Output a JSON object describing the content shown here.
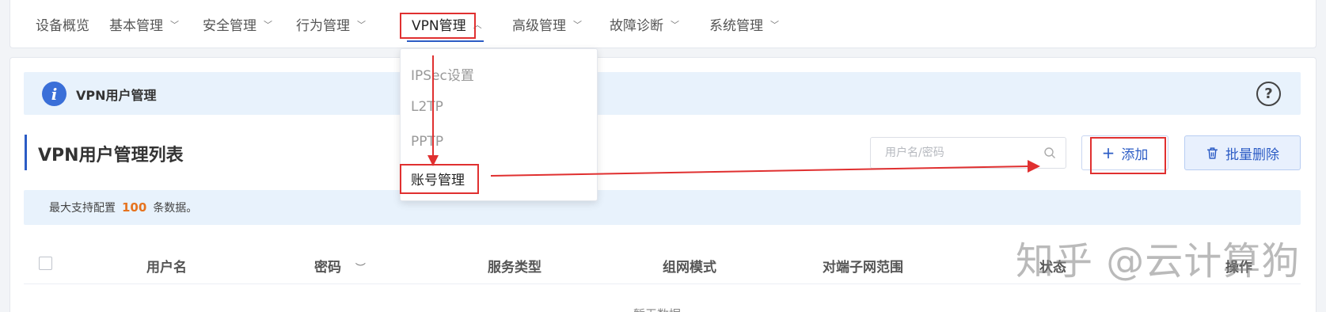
{
  "nav": {
    "items": [
      {
        "label": "设备概览",
        "chevron": ""
      },
      {
        "label": "基本管理",
        "chevron": "﹀"
      },
      {
        "label": "安全管理",
        "chevron": "﹀"
      },
      {
        "label": "行为管理",
        "chevron": "﹀"
      },
      {
        "label": "VPN管理",
        "chevron": "︿"
      },
      {
        "label": "高级管理",
        "chevron": "﹀"
      },
      {
        "label": "故障诊断",
        "chevron": "﹀"
      },
      {
        "label": "系统管理",
        "chevron": "﹀"
      }
    ],
    "active": "VPN管理"
  },
  "dropdown": {
    "items": [
      "IPSec设置",
      "L2TP",
      "PPTP",
      "账号管理"
    ],
    "selected": "账号管理"
  },
  "info": {
    "title": "VPN用户管理",
    "help_glyph": "?",
    "info_glyph": "i"
  },
  "list": {
    "title": "VPN用户管理列表"
  },
  "search": {
    "placeholder": "用户名/密码",
    "value": ""
  },
  "buttons": {
    "add_label": "添加",
    "add_glyph": "+",
    "batch_delete_label": "批量删除"
  },
  "notice": {
    "prefix": "最大支持配置",
    "max": "100",
    "suffix": "条数据。"
  },
  "table": {
    "columns": [
      "用户名",
      "密码",
      "服务类型",
      "组网模式",
      "对端子网范围",
      "状态",
      "操作"
    ],
    "password_toggle_glyph": "︶",
    "empty_text": "暂无数据"
  },
  "watermark": "知乎 @云计算狗",
  "colors": {
    "accent": "#2c5cc5",
    "annotation_red": "#e03030",
    "highlight_orange": "#e6731f",
    "info_bg": "#e8f2fc"
  },
  "icons": {
    "info": "info-circle-icon",
    "help": "question-circle-icon",
    "search": "search-icon",
    "add": "plus-icon",
    "delete": "trash-icon",
    "eye": "eye-closed-icon"
  }
}
